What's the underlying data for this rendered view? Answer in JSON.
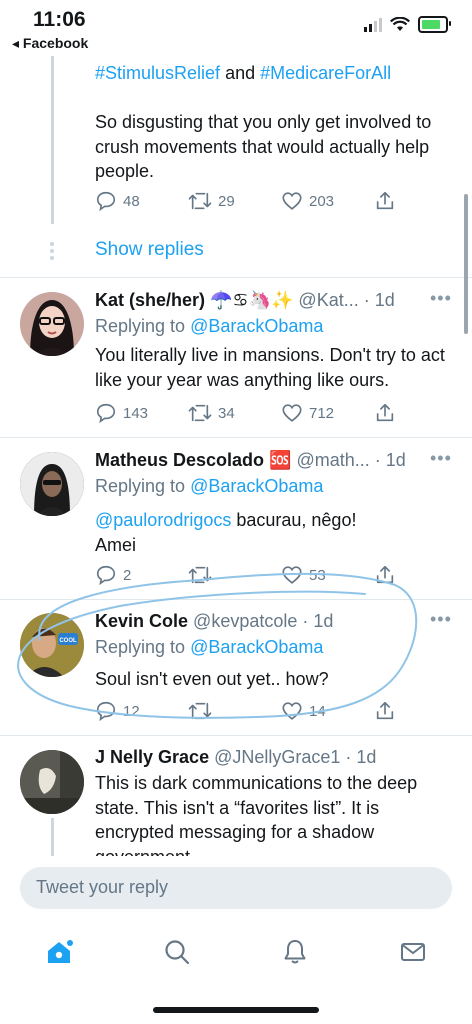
{
  "status_bar": {
    "time": "11:06",
    "back_label": "◂ Facebook"
  },
  "top_tweet": {
    "hashtag1": "#StimulusRelief",
    "and": " and ",
    "hashtag2": "#MedicareForAll",
    "text": "So disgusting that you only get involved to crush movements that would actually help people.",
    "replies": "48",
    "retweets": "29",
    "likes": "203",
    "show_replies": "Show replies"
  },
  "tweets": [
    {
      "name": "Kat (she/her) ☂️♋🦄✨",
      "handle": "@Kat...",
      "time": " · 1d",
      "replying_prefix": "Replying to ",
      "replying_to": "@BarackObama",
      "text": "You literally live in mansions. Don't try to act like your year was anything like ours.",
      "replies": "143",
      "retweets": "34",
      "likes": "712"
    },
    {
      "name": "Matheus Descolado 🆘",
      "handle": "@math...",
      "time": " · 1d",
      "replying_prefix": "Replying to ",
      "replying_to": "@BarackObama",
      "mention": "@paulorodrigocs",
      "text_after_mention": " bacurau, nêgo!",
      "text_line2": "Amei",
      "replies": "2",
      "retweets": "",
      "likes": "53"
    },
    {
      "name": "Kevin Cole",
      "handle": "@kevpatcole",
      "time": " · 1d",
      "replying_prefix": "Replying to ",
      "replying_to": "@BarackObama",
      "text": "Soul isn't even out yet.. how?",
      "replies": "12",
      "retweets": "",
      "likes": "14",
      "avatar_badge": "COOL"
    },
    {
      "name": "J Nelly Grace",
      "handle": "@JNellyGrace1",
      "time": " · 1d",
      "text": "This is dark communications to the deep state. This isn't a “favorites list”. It is encrypted messaging for a shadow government"
    }
  ],
  "composer": {
    "placeholder": "Tweet your reply"
  },
  "tabs": [
    "home-icon",
    "search-icon",
    "notifications-icon",
    "messages-icon"
  ],
  "colors": {
    "accent": "#1da1f2",
    "muted": "#657786",
    "annotation": "#8fc4e8"
  }
}
